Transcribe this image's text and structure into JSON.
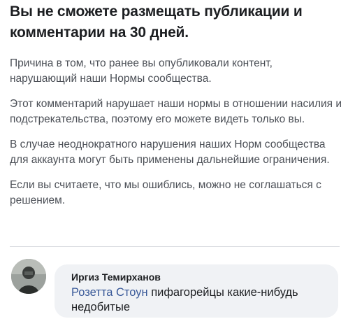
{
  "notice": {
    "title": "Вы не сможете размещать публикации и комментарии на 30 дней.",
    "paragraphs": [
      "Причина в том, что ранее вы опубликовали контент, нарушающий наши Нормы сообщества.",
      "Этот комментарий нарушает наши нормы в отношении насилия и подстрекательства, поэтому его можете видеть только вы.",
      "В случае неоднократного нарушения наших Норм сообщества для аккаунта могут быть применены дальнейшие ограничения.",
      "Если вы считаете, что мы ошиблись, можно не соглашаться с решением."
    ]
  },
  "comment": {
    "author": "Иргиз Темирханов",
    "mention": "Розетта Стоун",
    "text": " пифагорейцы какие-нибудь недобитые"
  },
  "colors": {
    "title": "#1c1e21",
    "body_text": "#4b4f56",
    "mention": "#385898",
    "bubble_background": "#f0f2f5"
  }
}
